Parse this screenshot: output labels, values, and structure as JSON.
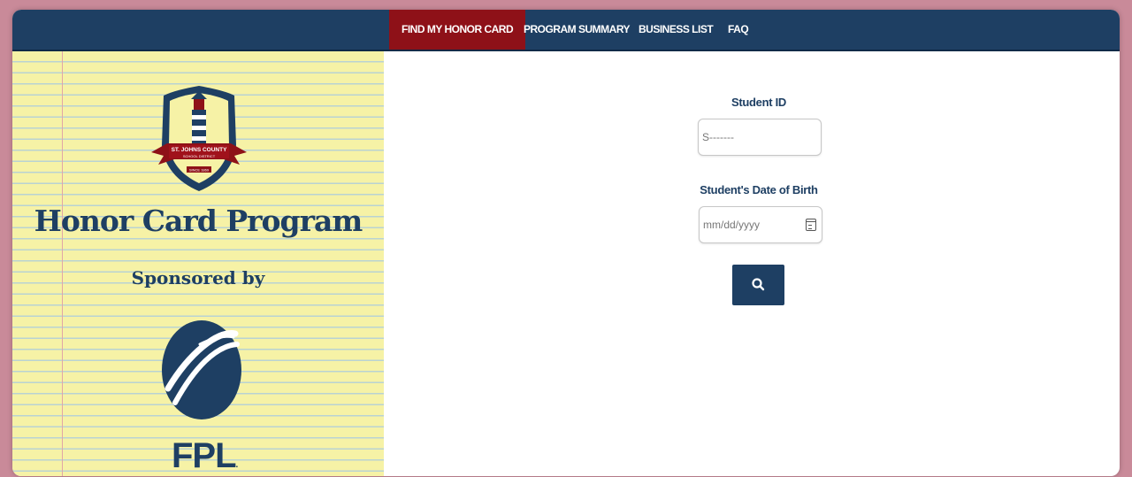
{
  "nav": {
    "items": [
      {
        "label": "FIND MY HONOR CARD",
        "active": true
      },
      {
        "label": "PROGRAM SUMMARY",
        "active": false
      },
      {
        "label": "BUSINESS LIST",
        "active": false
      },
      {
        "label": "FAQ",
        "active": false
      }
    ]
  },
  "sidebar": {
    "crest_lines": [
      "ST. JOHNS COUNTY",
      "SCHOOL DISTRICT",
      "SINCE 1869"
    ],
    "title": "Honor Card Program",
    "sponsor_label": "Sponsored by",
    "sponsor_logo_text": "FPL",
    "sponsor_logo_mark": "."
  },
  "form": {
    "student_id_label": "Student ID",
    "student_id_placeholder": "S-------",
    "dob_label": "Student's Date of Birth",
    "dob_placeholder": "mm/dd/yyyy",
    "search_icon": "search-icon",
    "calendar_icon": "calendar-icon"
  },
  "colors": {
    "navy": "#1e3f63",
    "active_tab": "#8e1118",
    "legal_pad": "#f6f2a6",
    "page_background": "#c98a99"
  }
}
